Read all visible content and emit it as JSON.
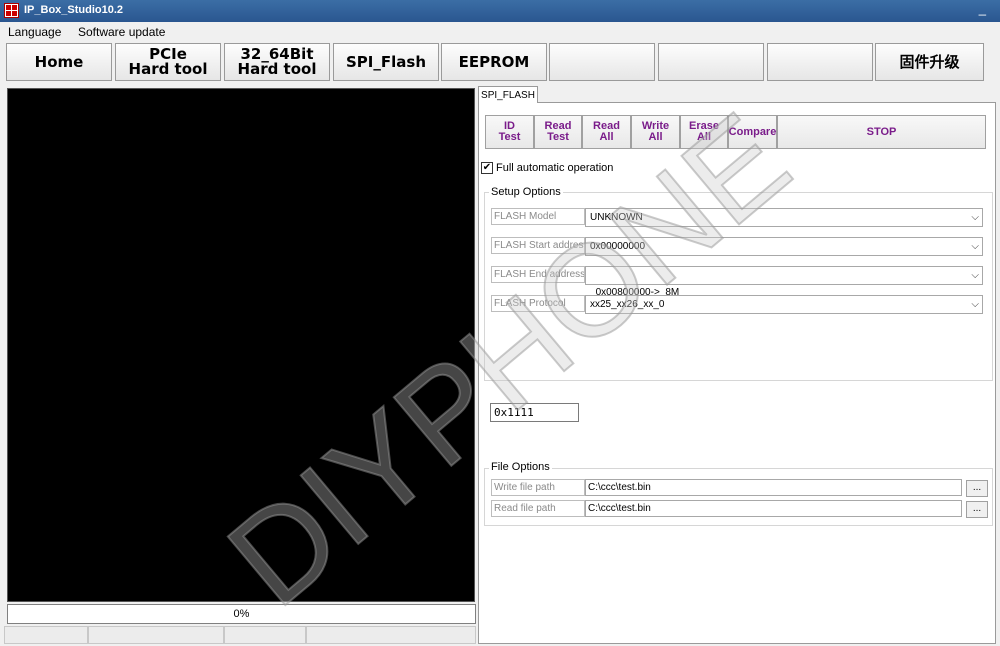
{
  "window": {
    "title": "IP_Box_Studio10.2",
    "minimize": "_"
  },
  "menu": {
    "items": [
      "Language",
      "Software update"
    ]
  },
  "nav": {
    "buttons": [
      "Home",
      "PCIe\nHard tool",
      "32_64Bit\nHard tool",
      "SPI_Flash",
      "EEPROM",
      "",
      "",
      "",
      "固件升级"
    ]
  },
  "progress": {
    "label": "0%",
    "value": 0
  },
  "spi": {
    "tab": "SPI_FLASH",
    "buttons": [
      "ID\nTest",
      "Read\nTest",
      "Read\nAll",
      "Write\nAll",
      "Erase\nAll",
      "Compare",
      "STOP"
    ],
    "full_auto_label": "Full automatic operation",
    "full_auto_checked": true,
    "setup": {
      "title": "Setup Options",
      "rows": [
        {
          "label": "FLASH Model",
          "value": "UNKNOWN"
        },
        {
          "label": "FLASH Start address",
          "value": "0x00000000"
        },
        {
          "label": "FLASH End address",
          "value": "0x00800000->  8M"
        },
        {
          "label": "FLASH Protocol",
          "value": "xx25_xx26_xx_0"
        }
      ]
    },
    "hex_value": "0x1111",
    "file": {
      "title": "File Options",
      "rows": [
        {
          "label": "Write file path",
          "value": "C:\\ccc\\test.bin",
          "browse": "..."
        },
        {
          "label": "Read file path",
          "value": "C:\\ccc\\test.bin",
          "browse": "..."
        }
      ]
    }
  },
  "watermark": "DIYPHONE"
}
